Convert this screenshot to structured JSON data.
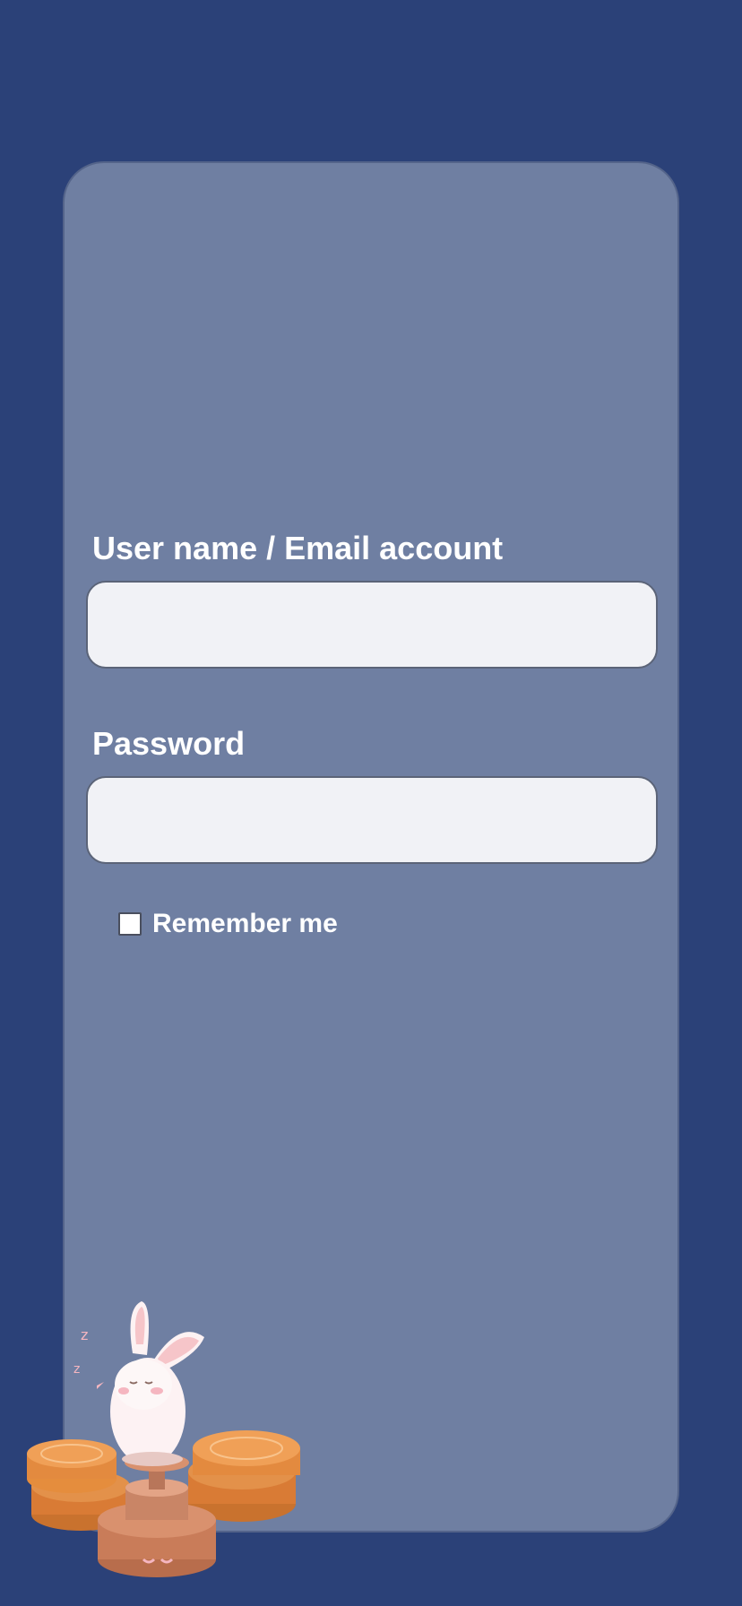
{
  "login_form": {
    "username_label": "User name / Email account",
    "username_value": "",
    "password_label": "Password",
    "password_value": "",
    "remember_label": "Remember me",
    "remember_checked": false
  },
  "colors": {
    "background": "#2b4178",
    "card": "#6f7fa2",
    "input_fill": "#f1f2f6",
    "text": "#ffffff",
    "mooncake": "#e38a3f"
  },
  "decoration": {
    "icon": "rabbit-on-mooncakes-illustration"
  }
}
